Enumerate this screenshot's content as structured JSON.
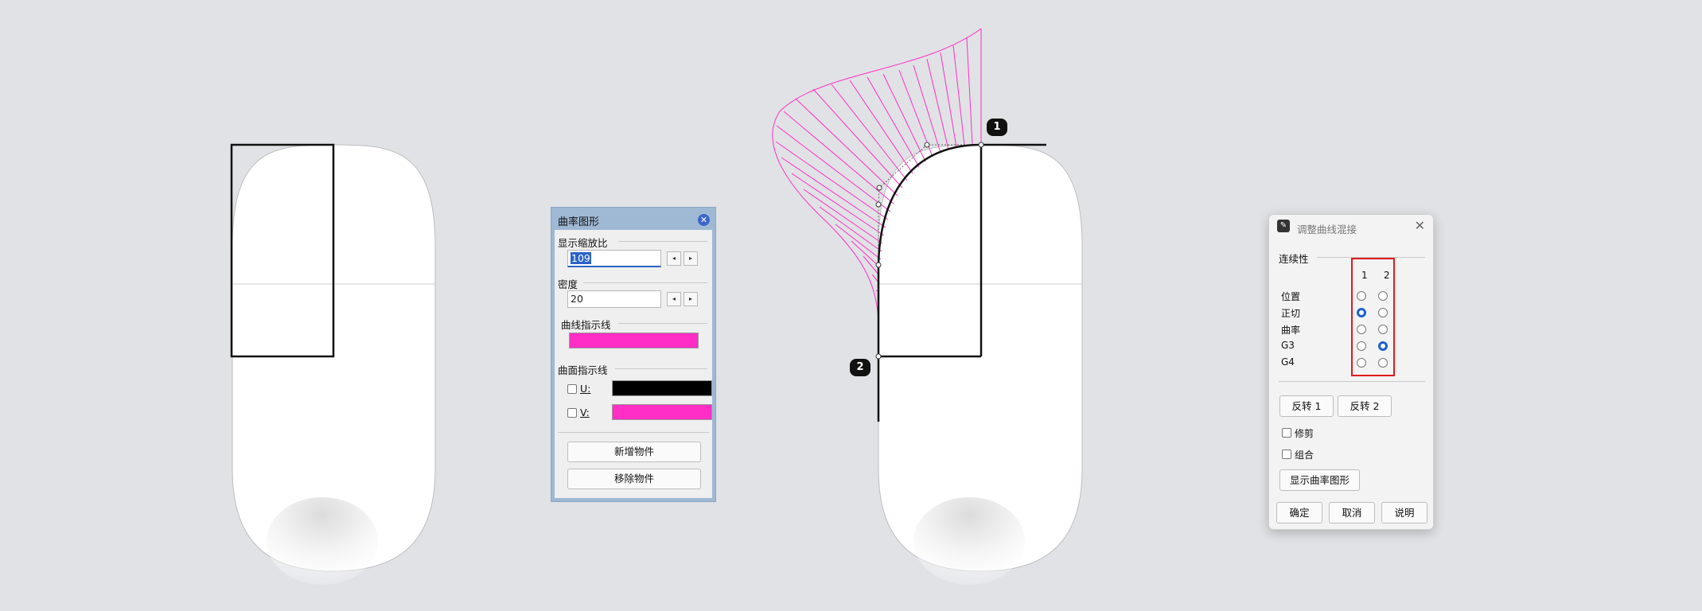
{
  "colors": {
    "background": "#e1e2e6",
    "curvature_hair": "#ff2ec4",
    "u_color": "#000000",
    "v_color": "#ff2ec4",
    "highlight_box": "#e01a1a",
    "accent": "#1f5fd1"
  },
  "viewport": {
    "badge_1": "1",
    "badge_2": "2"
  },
  "curvature_panel": {
    "title": "曲率图形",
    "close_icon": "close-icon",
    "scale_label": "显示缩放比",
    "scale_value": "109",
    "density_label": "密度",
    "density_value": "20",
    "curve_hair_label": "曲线指示线",
    "surface_hair_label": "曲面指示线",
    "u_label": "U:",
    "u_checked": false,
    "v_label": "V:",
    "v_checked": false,
    "add_objects": "新增物件",
    "remove_objects": "移除物件"
  },
  "blend_dialog": {
    "title": "调整曲线混接",
    "continuity_label": "连续性",
    "col_1": "1",
    "col_2": "2",
    "rows": [
      {
        "label": "位置",
        "end1": false,
        "end2": false
      },
      {
        "label": "正切",
        "end1": true,
        "end2": false
      },
      {
        "label": "曲率",
        "end1": false,
        "end2": false
      },
      {
        "label": "G3",
        "end1": false,
        "end2": true
      },
      {
        "label": "G4",
        "end1": false,
        "end2": false
      }
    ],
    "reverse_1": "反转 1",
    "reverse_2": "反转 2",
    "trim_label": "修剪",
    "trim_checked": false,
    "join_label": "组合",
    "join_checked": false,
    "show_curvature": "显示曲率图形",
    "ok": "确定",
    "cancel": "取消",
    "help": "说明"
  }
}
